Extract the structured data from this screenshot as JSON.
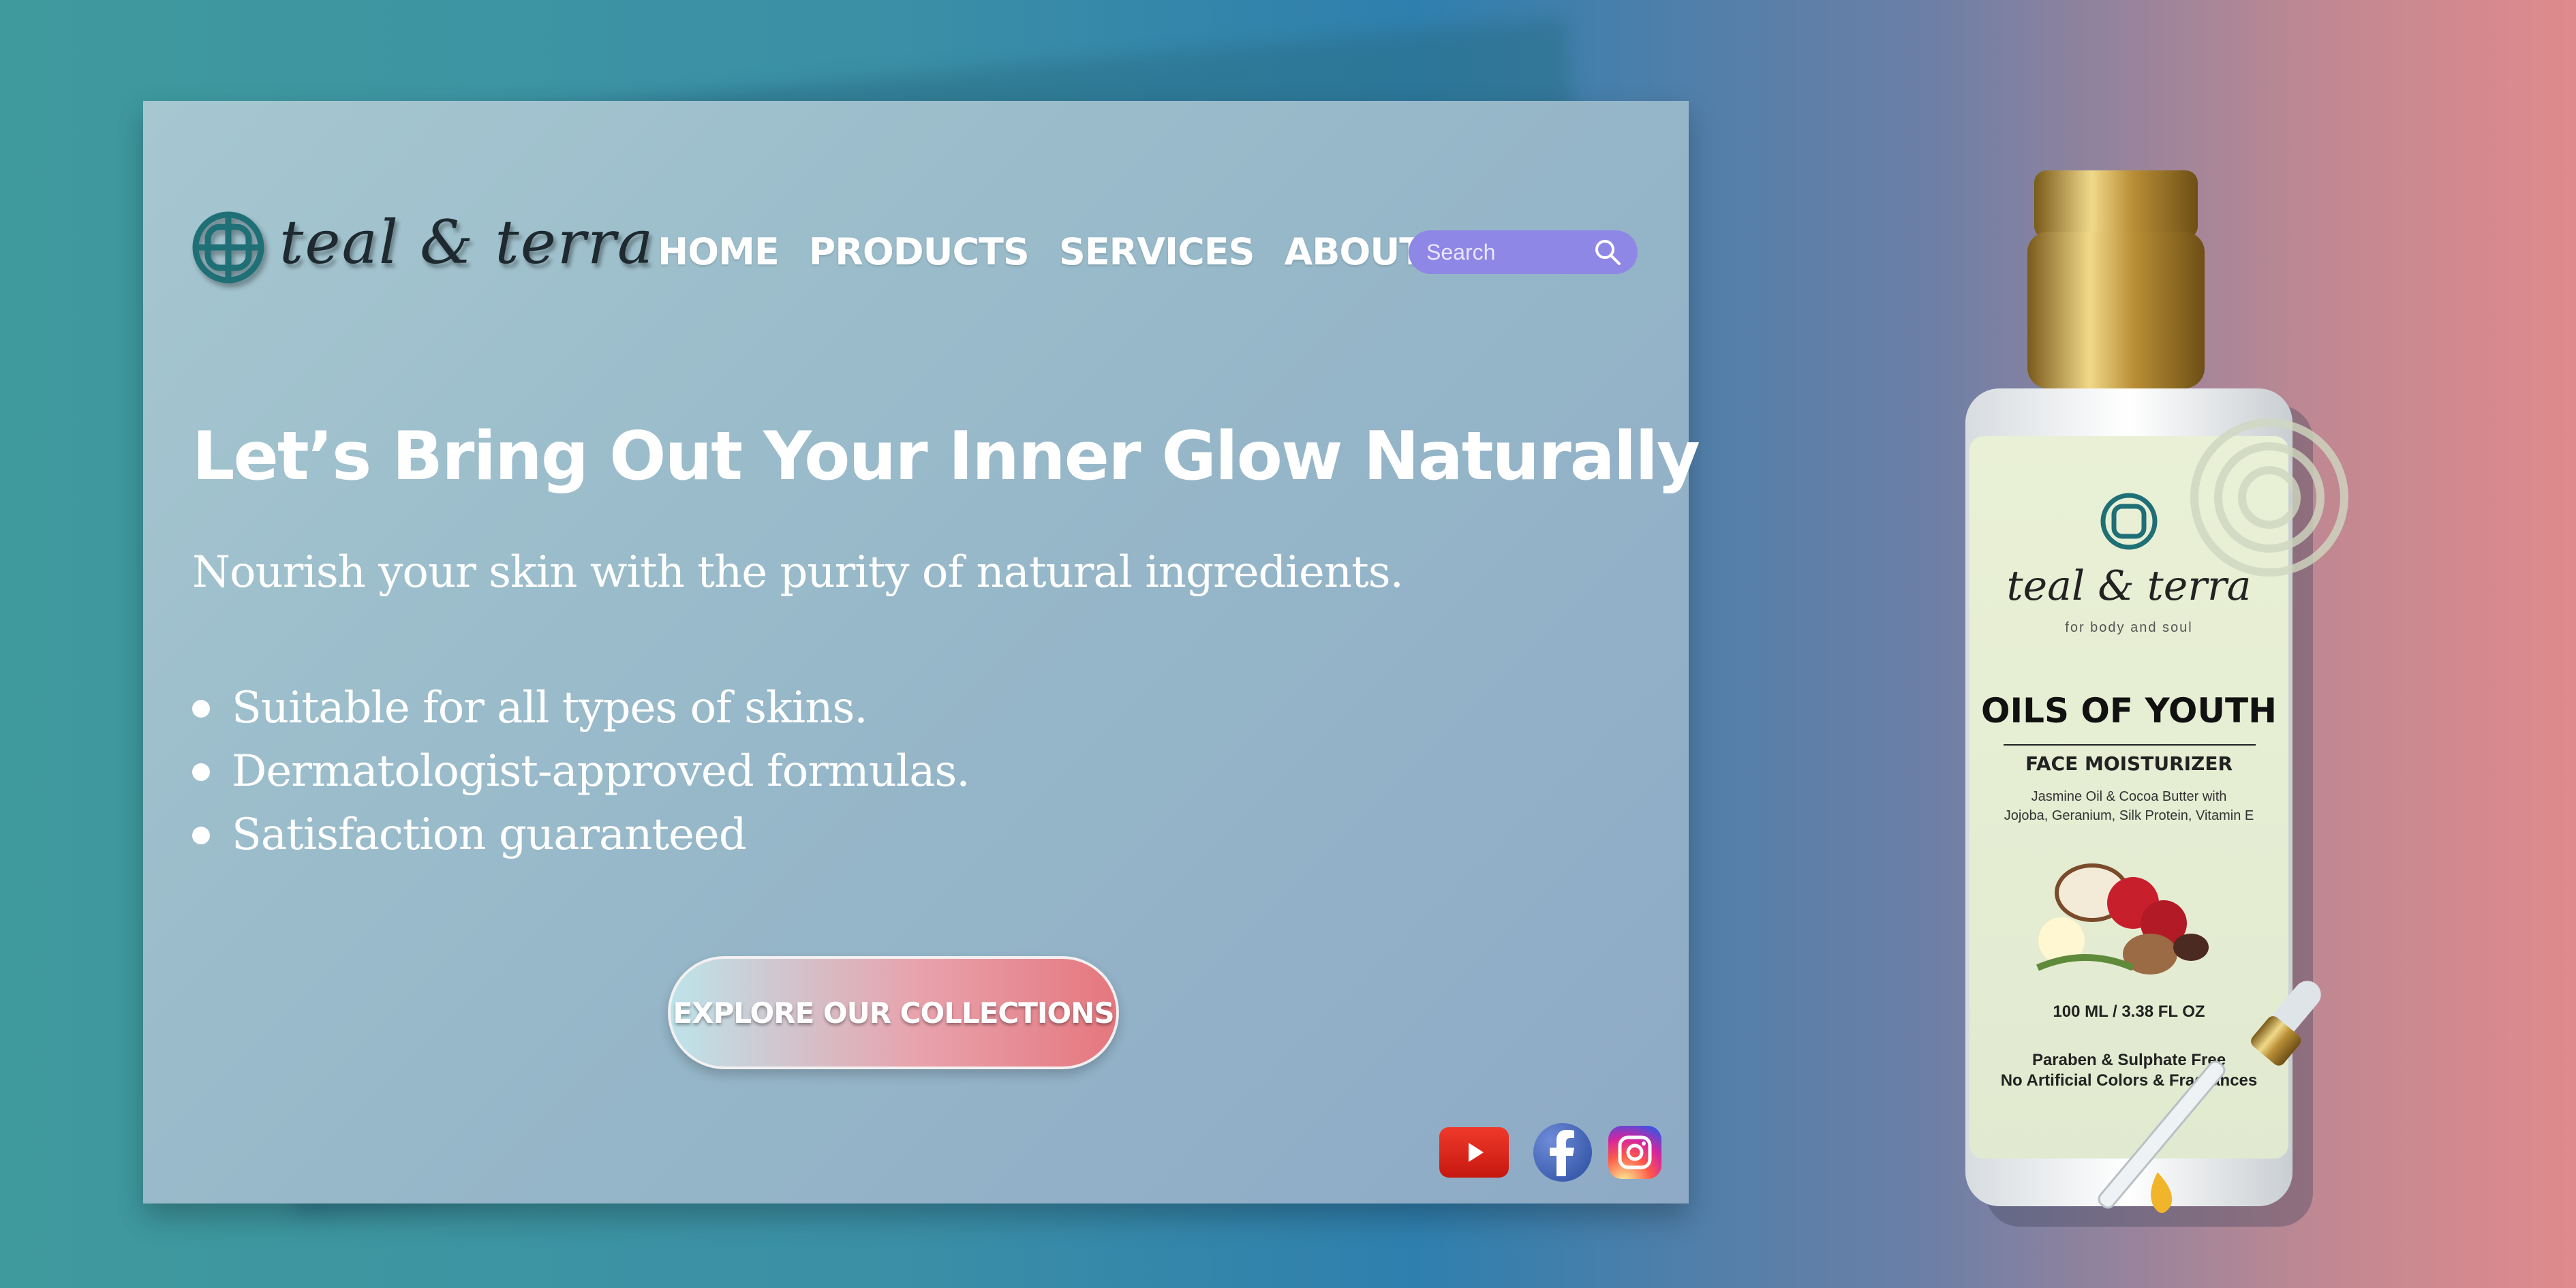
{
  "brand": {
    "name": "teal & terra",
    "accent_search": "#8f87e6"
  },
  "nav": {
    "items": [
      {
        "label": "HOME"
      },
      {
        "label": "PRODUCTS"
      },
      {
        "label": "SERVICES"
      },
      {
        "label": "ABOUT"
      }
    ]
  },
  "search": {
    "placeholder": "Search",
    "value": ""
  },
  "hero": {
    "headline": "Let’s Bring Out Your Inner Glow Naturally",
    "subtitle": "Nourish your skin with the purity of natural ingredients.",
    "bullets": [
      "Suitable for all types of skins.",
      "Dermatologist-approved formulas.",
      "Satisfaction guaranteed"
    ],
    "cta_label": "EXPLORE OUR COLLECTIONS"
  },
  "social": {
    "icons": [
      "youtube-icon",
      "facebook-icon",
      "instagram-icon"
    ]
  },
  "product": {
    "brand": "teal & terra",
    "tagline": "for body and soul",
    "name": "OILS OF YOUTH",
    "type": "FACE MOISTURIZER",
    "ingredients_line1": "Jasmine Oil & Cocoa Butter with",
    "ingredients_line2": "Jojoba, Geranium, Silk Protein, Vitamin E",
    "volume": "100 ML / 3.38 FL OZ",
    "claim1": "Paraben & Sulphate Free",
    "claim2": "No Artificial Colors & Fragrances"
  }
}
